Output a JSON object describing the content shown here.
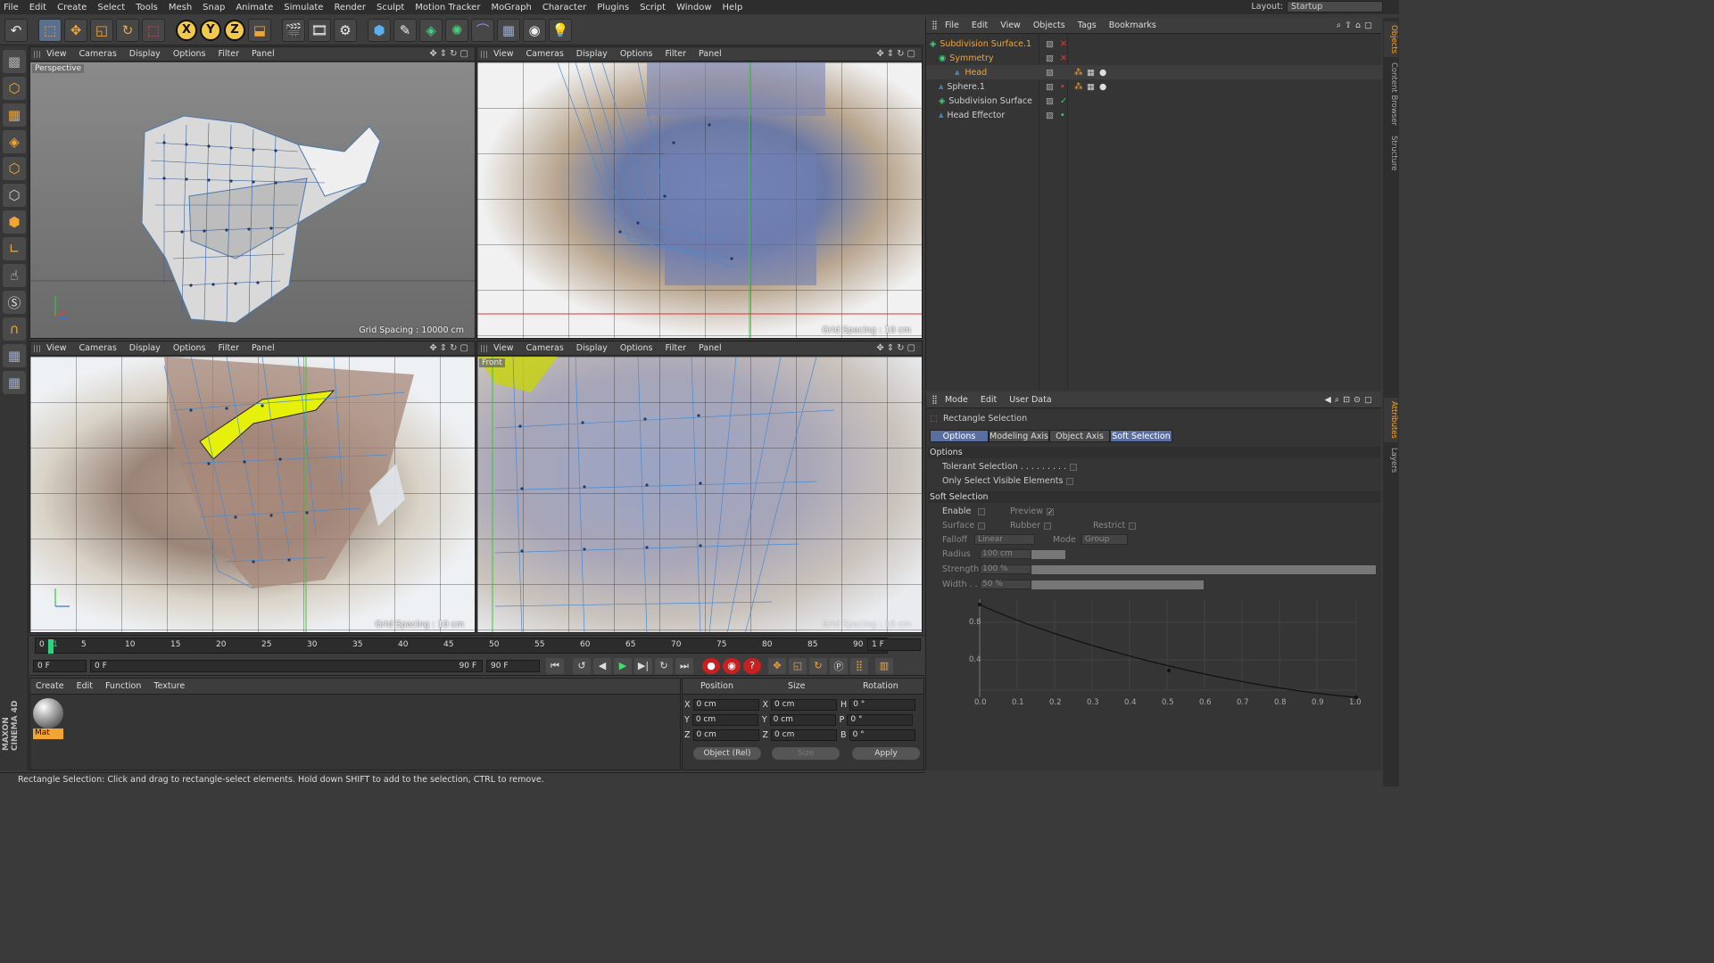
{
  "menu": [
    "File",
    "Edit",
    "Create",
    "Select",
    "Tools",
    "Mesh",
    "Snap",
    "Animate",
    "Simulate",
    "Render",
    "Sculpt",
    "Motion Tracker",
    "MoGraph",
    "Character",
    "Plugins",
    "Script",
    "Window",
    "Help"
  ],
  "layout": {
    "label": "Layout:",
    "value": "Startup"
  },
  "toolbar_icons": [
    "undo-icon",
    "live-selection-icon",
    "move-icon",
    "scale-icon",
    "rotate-icon",
    "recent-tool-icon",
    "x-axis-lock",
    "y-axis-lock",
    "z-axis-lock",
    "coordinate-system-icon",
    "render-view-icon",
    "render-picture-viewer-icon",
    "render-settings-icon",
    "cube-icon",
    "spline-pen-icon",
    "subdivision-icon",
    "array-icon",
    "deformer-icon",
    "floor-icon",
    "camera-icon",
    "light-icon"
  ],
  "axis_labels": [
    "X",
    "Y",
    "Z"
  ],
  "viewports": [
    {
      "menu": [
        "View",
        "Cameras",
        "Display",
        "Options",
        "Filter",
        "Panel"
      ],
      "label": "Perspective",
      "grid": "Grid Spacing : 10000 cm"
    },
    {
      "menu": [
        "View",
        "Cameras",
        "Display",
        "Options",
        "Filter",
        "Panel"
      ],
      "label": "",
      "grid": "Grid Spacing : 10 cm"
    },
    {
      "menu": [
        "View",
        "Cameras",
        "Display",
        "Options",
        "Filter",
        "Panel"
      ],
      "label": "",
      "grid": "Grid Spacing : 10 cm"
    },
    {
      "menu": [
        "View",
        "Cameras",
        "Display",
        "Options",
        "Filter",
        "Panel"
      ],
      "label": "Front",
      "grid": "Grid Spacing : 10 cm"
    }
  ],
  "timeline": {
    "ticks": [
      "0",
      "5",
      "10",
      "15",
      "20",
      "25",
      "30",
      "35",
      "40",
      "45",
      "50",
      "55",
      "60",
      "65",
      "70",
      "75",
      "80",
      "85",
      "90"
    ],
    "current": "1",
    "end_frame": "1 F",
    "start_field": "0 F",
    "range_start": "0 F",
    "range_end": "90 F",
    "max_field": "90 F"
  },
  "material_panel": {
    "menu": [
      "Create",
      "Edit",
      "Function",
      "Texture"
    ],
    "material_name": "Mat"
  },
  "coordinates": {
    "headers": [
      "Position",
      "Size",
      "Rotation"
    ],
    "rows": [
      {
        "axis": "X",
        "pos": "0 cm",
        "size_axis": "X",
        "size": "0 cm",
        "rot_axis": "H",
        "rot": "0 °"
      },
      {
        "axis": "Y",
        "pos": "0 cm",
        "size_axis": "Y",
        "size": "0 cm",
        "rot_axis": "P",
        "rot": "0 °"
      },
      {
        "axis": "Z",
        "pos": "0 cm",
        "size_axis": "Z",
        "size": "0 cm",
        "rot_axis": "B",
        "rot": "0 °"
      }
    ],
    "mode": "Object (Rel)",
    "size_mode": "Size",
    "apply": "Apply"
  },
  "objects_panel": {
    "menu": [
      "File",
      "Edit",
      "View",
      "Objects",
      "Tags",
      "Bookmarks"
    ],
    "items": [
      {
        "name": "Subdivision Surface.1",
        "indent": 0,
        "color": "#f3a533"
      },
      {
        "name": "Symmetry",
        "indent": 1,
        "color": "#f3a533"
      },
      {
        "name": "Head",
        "indent": 2,
        "color": "#f3a533"
      },
      {
        "name": "Sphere.1",
        "indent": 0,
        "color": "#dddddd"
      },
      {
        "name": "Subdivision Surface",
        "indent": 0,
        "color": "#dddddd"
      },
      {
        "name": "Head Effector",
        "indent": 0,
        "color": "#dddddd"
      }
    ]
  },
  "side_tabs": [
    "Objects",
    "Content Browser",
    "Structure",
    "Attributes",
    "Layers"
  ],
  "attributes": {
    "menu": [
      "Mode",
      "Edit",
      "User Data"
    ],
    "title": "Rectangle Selection",
    "tabs": [
      "Options",
      "Modeling Axis",
      "Object Axis",
      "Soft Selection"
    ],
    "options_header": "Options",
    "tolerant": "Tolerant Selection . . . . . . . . .",
    "only_visible": "Only Select Visible Elements",
    "soft_header": "Soft Selection",
    "enable": "Enable",
    "preview": "Preview",
    "surface": "Surface",
    "rubber": "Rubber",
    "restrict": "Restrict",
    "falloff": "Falloff",
    "falloff_val": "Linear",
    "mode": "Mode",
    "mode_val": "Group",
    "radius": "Radius",
    "radius_val": "100 cm",
    "strength": "Strength",
    "strength_val": "100 %",
    "width": "Width . .",
    "width_val": "50 %",
    "curve_y": [
      "0.8",
      "0.4"
    ],
    "curve_x": [
      "0.0",
      "0.1",
      "0.2",
      "0.3",
      "0.4",
      "0.5",
      "0.6",
      "0.7",
      "0.8",
      "0.9",
      "1.0"
    ]
  },
  "maxon": "MAXON CINEMA 4D",
  "status": "Rectangle Selection: Click and drag to rectangle-select elements. Hold down SHIFT to add to the selection, CTRL to remove."
}
